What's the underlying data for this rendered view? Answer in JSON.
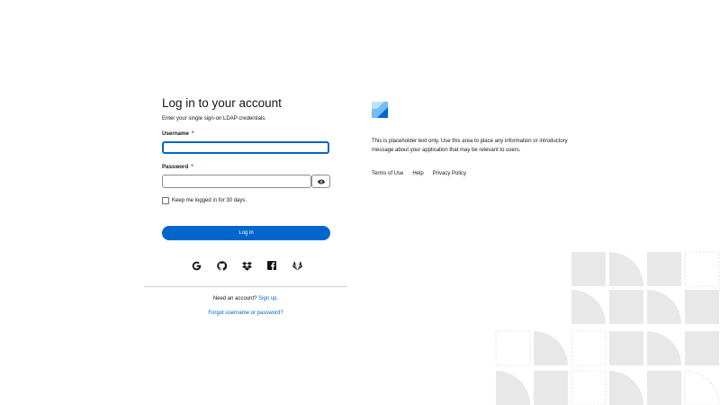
{
  "login": {
    "title": "Log in to your account",
    "subtitle": "Enter your single sign-on LDAP credentials.",
    "username_label": "Username",
    "username_value": "",
    "password_label": "Password",
    "password_value": "",
    "required_marker": "*",
    "keep_logged_in_label": "Keep me logged in for 30 days.",
    "login_button": "Log in",
    "social_icons": [
      "google-icon",
      "github-icon",
      "dropbox-icon",
      "facebook-icon",
      "gitlab-icon"
    ],
    "need_account": "Need an account?",
    "sign_up": "Sign up.",
    "forgot": "Forgot username or password?"
  },
  "info": {
    "logo_icon": "brand-logo-icon",
    "text": "This is placeholder text only. Use this area to place any information or introductory message about your application that may be relevant to users.",
    "links": [
      "Terms of Use",
      "Help",
      "Privacy Policy"
    ]
  },
  "colors": {
    "primary": "#0066cc",
    "required": "#c9190b",
    "text": "#151515",
    "border": "#8a8d90",
    "pattern": "#e8e8e8",
    "logo_light": "#73bcf7",
    "logo_dark": "#0066cc"
  }
}
